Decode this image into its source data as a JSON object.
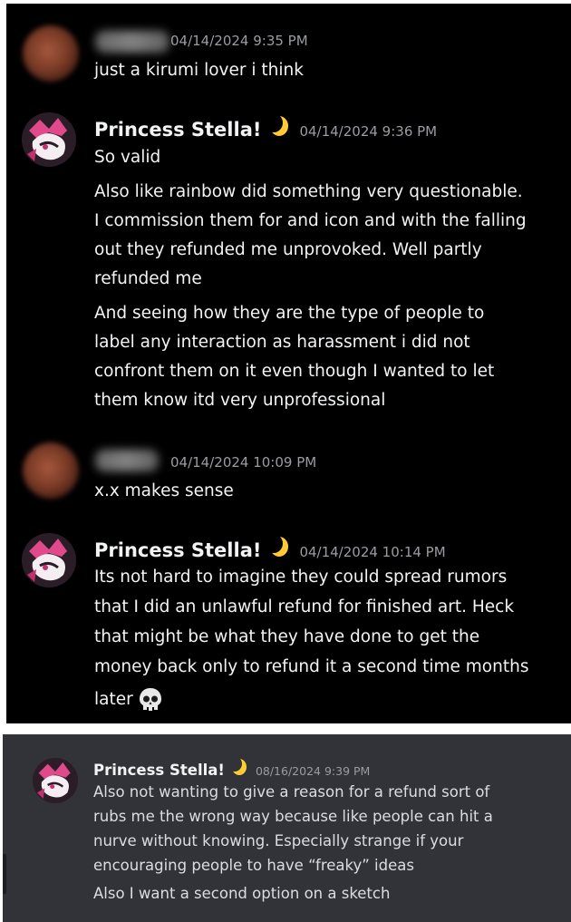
{
  "top_panel": {
    "messages": [
      {
        "author": "",
        "timestamp": "04/14/2024 9:35 PM",
        "lines": [
          "just a kirumi lover i think"
        ]
      },
      {
        "author": "Princess Stella!",
        "timestamp": "04/14/2024 9:36 PM",
        "lines": [
          "So valid",
          "Also like rainbow did something very questionable.",
          "I commission them for and icon and with the falling",
          "out they refunded me unprovoked. Well partly",
          "refunded me",
          "And seeing how they are the type of people to",
          "label any interaction as harassment i did not",
          "confront them on it even though I wanted to let",
          "them know itd very unprofessional"
        ]
      },
      {
        "author": "",
        "timestamp": "04/14/2024 10:09 PM",
        "lines": [
          "x.x makes sense"
        ]
      },
      {
        "author": "Princess Stella!",
        "timestamp": "04/14/2024 10:14 PM",
        "lines": [
          "Its not hard to imagine they could spread rumors",
          "that I did an unlawful refund for finished art. Heck",
          "that might be what they have done to get the",
          "money back only to refund it a second time months",
          "later"
        ],
        "trailing_emoji": "skull-icon"
      }
    ]
  },
  "bottom_panel": {
    "message": {
      "author": "Princess Stella!",
      "timestamp": "08/16/2024 9:39 PM",
      "lines": [
        "Also not wanting to give a reason for a refund sort of",
        "rubs me the wrong way because like people can hit a",
        "nurve without knowing. Especially strange if your",
        "encouraging people to have “freaky” ideas",
        "Also I want a second option on a sketch"
      ]
    }
  },
  "colors": {
    "top_background": "#000000",
    "bottom_background": "#313338",
    "text": "#f2f3f5",
    "timestamp": "#9a9ca3",
    "moon": "#ffcc33"
  }
}
